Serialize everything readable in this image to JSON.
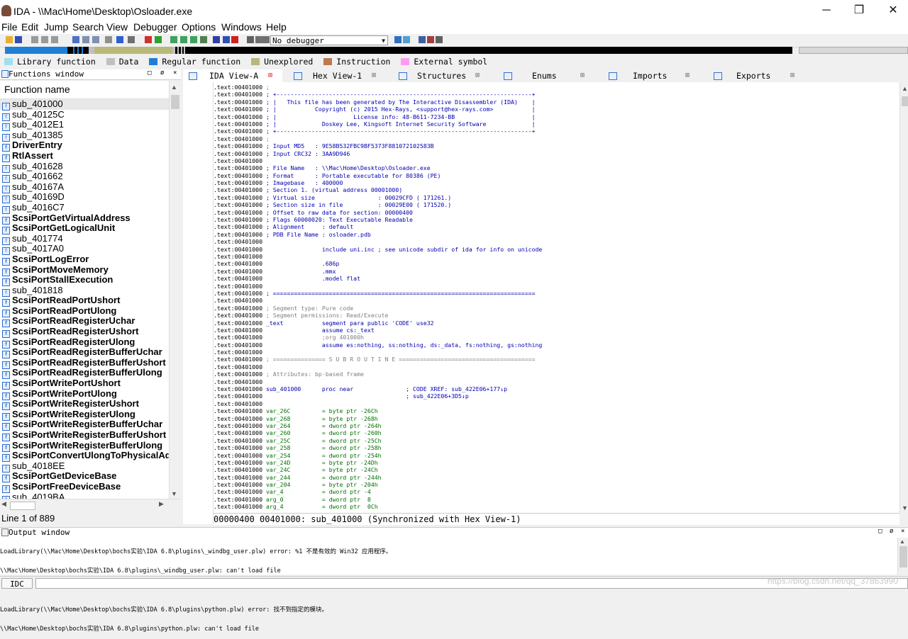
{
  "window": {
    "title": "IDA - \\\\Mac\\Home\\Desktop\\Osloader.exe",
    "minimize": "─",
    "maximize": "❐",
    "close": "✕"
  },
  "menu": [
    "File",
    "Edit",
    "Jump",
    "Search",
    "View",
    "Debugger",
    "Options",
    "Windows",
    "Help"
  ],
  "toolbar": {
    "debugger_select": "No debugger"
  },
  "legend": [
    {
      "label": "Library function",
      "color": "#a0e0f0"
    },
    {
      "label": "Data",
      "color": "#c0c0c0"
    },
    {
      "label": "Regular function",
      "color": "#1f7fd6"
    },
    {
      "label": "Unexplored",
      "color": "#b8b87a"
    },
    {
      "label": "Instruction",
      "color": "#c07850"
    },
    {
      "label": "External symbol",
      "color": "#ff9cf0"
    }
  ],
  "functions_window": {
    "title": "Functions window",
    "column": "Function name",
    "items": [
      {
        "name": "sub_401000",
        "bold": false
      },
      {
        "name": "sub_40125C",
        "bold": false
      },
      {
        "name": "sub_4012E1",
        "bold": false
      },
      {
        "name": "sub_401385",
        "bold": false
      },
      {
        "name": "DriverEntry",
        "bold": true
      },
      {
        "name": "RtlAssert",
        "bold": true
      },
      {
        "name": "sub_401628",
        "bold": false
      },
      {
        "name": "sub_401662",
        "bold": false
      },
      {
        "name": "sub_40167A",
        "bold": false
      },
      {
        "name": "sub_40169D",
        "bold": false
      },
      {
        "name": "sub_4016C7",
        "bold": false
      },
      {
        "name": "ScsiPortGetVirtualAddress",
        "bold": true
      },
      {
        "name": "ScsiPortGetLogicalUnit",
        "bold": true
      },
      {
        "name": "sub_401774",
        "bold": false
      },
      {
        "name": "sub_4017A0",
        "bold": false
      },
      {
        "name": "ScsiPortLogError",
        "bold": true
      },
      {
        "name": "ScsiPortMoveMemory",
        "bold": true
      },
      {
        "name": "ScsiPortStallExecution",
        "bold": true
      },
      {
        "name": "sub_401818",
        "bold": false
      },
      {
        "name": "ScsiPortReadPortUshort",
        "bold": true
      },
      {
        "name": "ScsiPortReadPortUlong",
        "bold": true
      },
      {
        "name": "ScsiPortReadRegisterUchar",
        "bold": true
      },
      {
        "name": "ScsiPortReadRegisterUshort",
        "bold": true
      },
      {
        "name": "ScsiPortReadRegisterUlong",
        "bold": true
      },
      {
        "name": "ScsiPortReadRegisterBufferUchar",
        "bold": true
      },
      {
        "name": "ScsiPortReadRegisterBufferUshort",
        "bold": true
      },
      {
        "name": "ScsiPortReadRegisterBufferUlong",
        "bold": true
      },
      {
        "name": "ScsiPortWritePortUshort",
        "bold": true
      },
      {
        "name": "ScsiPortWritePortUlong",
        "bold": true
      },
      {
        "name": "ScsiPortWriteRegisterUshort",
        "bold": true
      },
      {
        "name": "ScsiPortWriteRegisterUlong",
        "bold": true
      },
      {
        "name": "ScsiPortWriteRegisterBufferUchar",
        "bold": true
      },
      {
        "name": "ScsiPortWriteRegisterBufferUshort",
        "bold": true
      },
      {
        "name": "ScsiPortWriteRegisterBufferUlong",
        "bold": true
      },
      {
        "name": "ScsiPortConvertUlongToPhysicalAd",
        "bold": true
      },
      {
        "name": "sub_4018EE",
        "bold": false
      },
      {
        "name": "ScsiPortGetDeviceBase",
        "bold": true
      },
      {
        "name": "ScsiPortFreeDeviceBase",
        "bold": true
      },
      {
        "name": "sub_4019BA",
        "bold": false
      }
    ],
    "line_info": "Line 1 of 889"
  },
  "tabs": [
    {
      "label": "IDA View-A",
      "active": true
    },
    {
      "label": "Hex View-1",
      "active": false
    },
    {
      "label": "Structures",
      "active": false
    },
    {
      "label": "Enums",
      "active": false
    },
    {
      "label": "Imports",
      "active": false
    },
    {
      "label": "Exports",
      "active": false
    }
  ],
  "disasm_lines": [
    [
      ".text:00401000",
      " ;",
      "c"
    ],
    [
      ".text:00401000",
      " ; +-------------------------------------------------------------------------+",
      "n"
    ],
    [
      ".text:00401000",
      " ; |   This file has been generated by The Interactive Disassembler (IDA)    |",
      "n"
    ],
    [
      ".text:00401000",
      " ; |           Copyright (c) 2015 Hex-Rays, <support@hex-rays.com>           |",
      "n"
    ],
    [
      ".text:00401000",
      " ; |                      License info: 48-B611-7234-BB                      |",
      "n"
    ],
    [
      ".text:00401000",
      " ; |             Doskey Lee, Kingsoft Internet Security Software             |",
      "n"
    ],
    [
      ".text:00401000",
      " ; +-------------------------------------------------------------------------+",
      "n"
    ],
    [
      ".text:00401000",
      " ;",
      "c"
    ],
    [
      ".text:00401000",
      " ; Input MD5   : 9E58B532FBC9BF5373F881072102583B",
      "n"
    ],
    [
      ".text:00401000",
      " ; Input CRC32 : 3AA9D946",
      "n"
    ],
    [
      ".text:00401000",
      "",
      "n"
    ],
    [
      ".text:00401000",
      " ; File Name   : \\\\Mac\\Home\\Desktop\\Osloader.exe",
      "n"
    ],
    [
      ".text:00401000",
      " ; Format      : Portable executable for 80386 (PE)",
      "n"
    ],
    [
      ".text:00401000",
      " ; Imagebase   : 400000",
      "n"
    ],
    [
      ".text:00401000",
      " ; Section 1. (virtual address 00001000)",
      "n"
    ],
    [
      ".text:00401000",
      " ; Virtual size                  : 00029CFD ( 171261.)",
      "n"
    ],
    [
      ".text:00401000",
      " ; Section size in file          : 00029E00 ( 171520.)",
      "n"
    ],
    [
      ".text:00401000",
      " ; Offset to raw data for section: 00000400",
      "n"
    ],
    [
      ".text:00401000",
      " ; Flags 60000020: Text Executable Readable",
      "n"
    ],
    [
      ".text:00401000",
      " ; Alignment     : default",
      "n"
    ],
    [
      ".text:00401000",
      " ; PDB File Name : osloader.pdb",
      "n"
    ],
    [
      ".text:00401000",
      "",
      "n"
    ],
    [
      ".text:00401000",
      "                 include uni.inc ; see unicode subdir of ida for info on unicode",
      "n"
    ],
    [
      ".text:00401000",
      "",
      "n"
    ],
    [
      ".text:00401000",
      "                 .686p",
      "n"
    ],
    [
      ".text:00401000",
      "                 .mmx",
      "n"
    ],
    [
      ".text:00401000",
      "                 .model flat",
      "n"
    ],
    [
      ".text:00401000",
      "",
      "n"
    ],
    [
      ".text:00401000",
      " ; ===========================================================================",
      "n"
    ],
    [
      ".text:00401000",
      "",
      "n"
    ],
    [
      ".text:00401000",
      " ; Segment type: Pure code",
      "c"
    ],
    [
      ".text:00401000",
      " ; Segment permissions: Read/Execute",
      "c"
    ],
    [
      ".text:00401000",
      " _text           segment para public 'CODE' use32",
      "n"
    ],
    [
      ".text:00401000",
      "                 assume cs:_text",
      "n"
    ],
    [
      ".text:00401000",
      "                 ;org 401000h",
      "c"
    ],
    [
      ".text:00401000",
      "                 assume es:nothing, ss:nothing, ds:_data, fs:nothing, gs:nothing",
      "n"
    ],
    [
      ".text:00401000",
      "",
      "n"
    ],
    [
      ".text:00401000",
      " ; =============== S U B R O U T I N E =======================================",
      "c"
    ],
    [
      ".text:00401000",
      "",
      "n"
    ],
    [
      ".text:00401000",
      " ; Attributes: bp-based frame",
      "c"
    ],
    [
      ".text:00401000",
      "",
      "n"
    ],
    [
      ".text:00401000",
      " sub_401000      proc near               ; CODE XREF: sub_422E06+177↓p",
      "n"
    ],
    [
      ".text:00401000",
      "                                         ; sub_422E06+3D5↓p",
      "n"
    ],
    [
      ".text:00401000",
      "",
      "n"
    ],
    [
      ".text:00401000",
      " var_26C         = byte ptr -26Ch",
      "s"
    ],
    [
      ".text:00401000",
      " var_268         = byte ptr -268h",
      "s"
    ],
    [
      ".text:00401000",
      " var_264         = dword ptr -264h",
      "s"
    ],
    [
      ".text:00401000",
      " var_260         = dword ptr -260h",
      "s"
    ],
    [
      ".text:00401000",
      " var_25C         = dword ptr -25Ch",
      "s"
    ],
    [
      ".text:00401000",
      " var_258         = dword ptr -258h",
      "s"
    ],
    [
      ".text:00401000",
      " var_254         = dword ptr -254h",
      "s"
    ],
    [
      ".text:00401000",
      " var_24D         = byte ptr -24Dh",
      "s"
    ],
    [
      ".text:00401000",
      " var_24C         = byte ptr -24Ch",
      "s"
    ],
    [
      ".text:00401000",
      " var_244         = dword ptr -244h",
      "s"
    ],
    [
      ".text:00401000",
      " var_204         = byte ptr -204h",
      "s"
    ],
    [
      ".text:00401000",
      " var_4           = dword ptr -4",
      "s"
    ],
    [
      ".text:00401000",
      " arg_0           = dword ptr  8",
      "s"
    ],
    [
      ".text:00401000",
      " arg_4           = dword ptr  0Ch",
      "s"
    ]
  ],
  "status_bar": "00000400 00401000: sub_401000 (Synchronized with Hex View-1)",
  "output_window": {
    "title": "Output window",
    "lines": [
      "LoadLibrary(\\\\Mac\\Home\\Desktop\\bochs实验\\IDA 6.8\\plugins\\_windbg_user.plw) error: %1 不是有效的 Win32 应用程序。",
      "\\\\Mac\\Home\\Desktop\\bochs实验\\IDA 6.8\\plugins\\_windbg_user.plw: can't load file",
      "",
      "LoadLibrary(\\\\Mac\\Home\\Desktop\\bochs实验\\IDA 6.8\\plugins\\python.plw) error: 找不到指定的模块。",
      "\\\\Mac\\Home\\Desktop\\bochs实验\\IDA 6.8\\plugins\\python.plw: can't load file"
    ]
  },
  "command_bar": {
    "label": "IDC"
  },
  "watermark": "https://blog.csdn.net/qq_37863990"
}
